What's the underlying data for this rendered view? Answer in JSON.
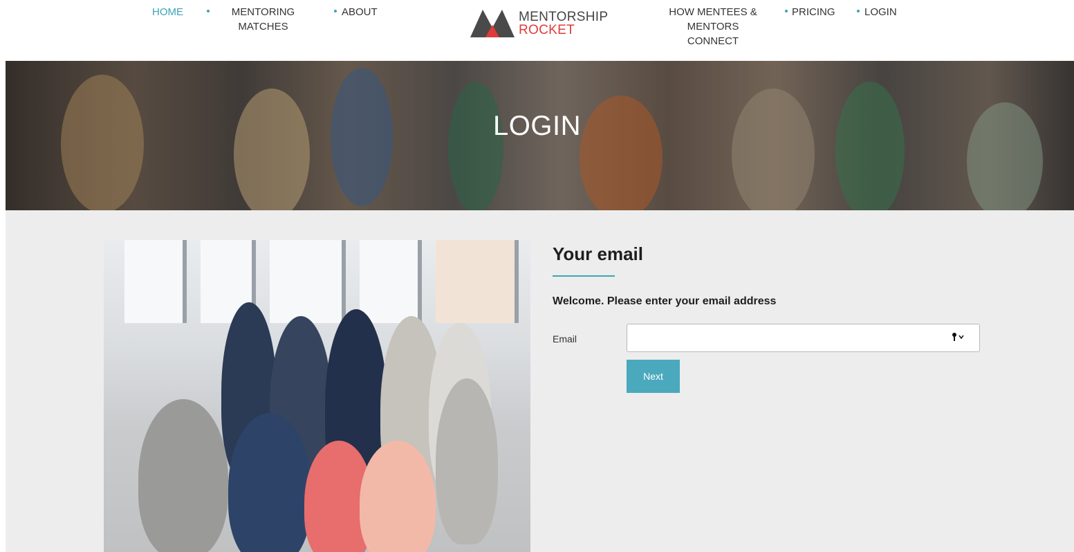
{
  "nav": {
    "home": "HOME",
    "mentoring_matches": "MENTORING MATCHES",
    "about": "ABOUT",
    "how_connect": "HOW MENTEES & MENTORS CONNECT",
    "pricing": "PRICING",
    "login": "LOGIN"
  },
  "logo": {
    "line1": "MENTORSHIP",
    "line2": "ROCKET"
  },
  "hero": {
    "title": "LOGIN"
  },
  "form": {
    "title": "Your email",
    "welcome": "Welcome. Please enter your email address",
    "email_label": "Email",
    "email_value": "",
    "next_label": "Next"
  },
  "colors": {
    "accent": "#3ba3b8",
    "brand_red": "#e03a3a",
    "button": "#4aa9bd"
  }
}
